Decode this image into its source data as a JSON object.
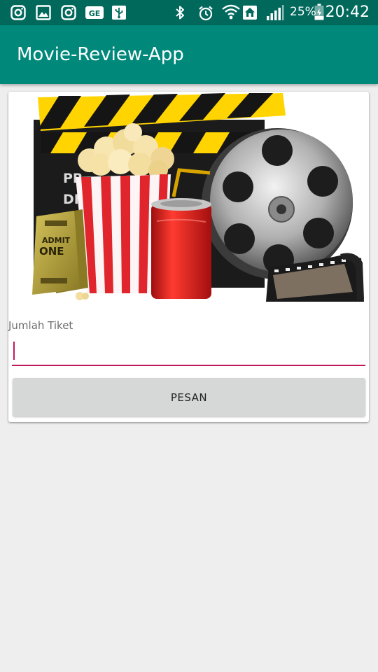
{
  "status_bar": {
    "battery": "25%",
    "time": "20:42",
    "left_icons": [
      "instagram-icon",
      "gallery-icon",
      "instagram-icon",
      "ge-badge-icon",
      "usb-icon"
    ],
    "right_icons": [
      "bluetooth-icon",
      "alarm-icon",
      "wifi-icon",
      "home-icon",
      "signal-icon",
      "battery-icon"
    ],
    "ge_badge": "GE"
  },
  "app_bar": {
    "title": "Movie-Review-App",
    "color": "#00897b",
    "status_color": "#00695c"
  },
  "banner": {
    "slate_text_1": "PR",
    "slate_text_2": "DI",
    "ticket_text_1": "ADMIT",
    "ticket_text_2": "ONE"
  },
  "form": {
    "ticket_label": "Jumlah Tiket",
    "ticket_value": "",
    "accent_color": "#c2185b"
  },
  "button": {
    "label": "PESAN"
  }
}
